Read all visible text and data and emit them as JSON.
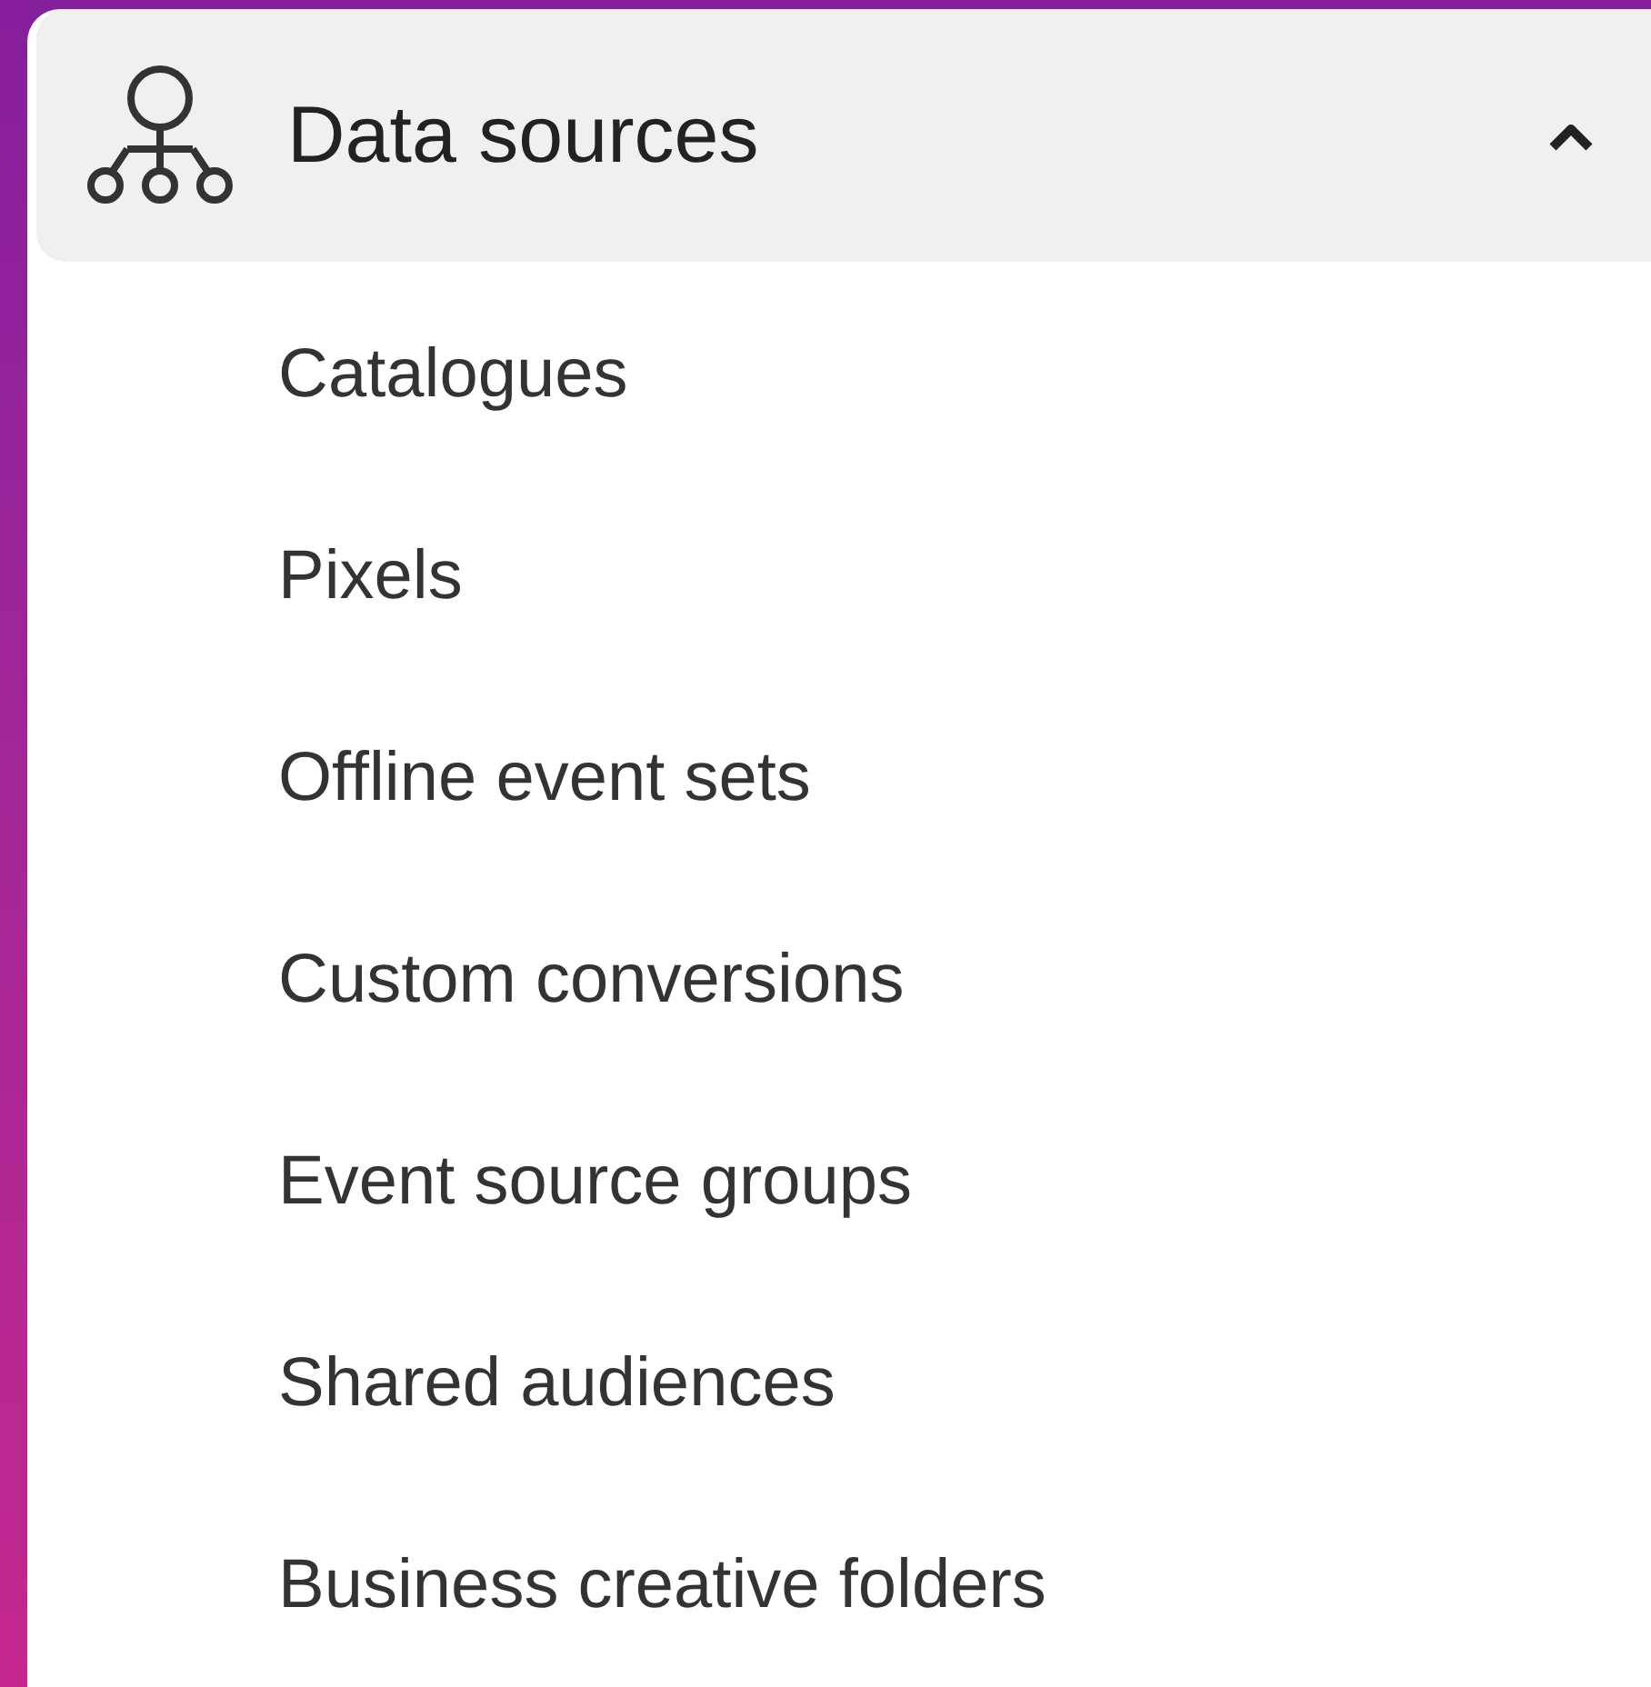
{
  "section": {
    "title": "Data sources",
    "expanded": true,
    "items": [
      {
        "label": "Catalogues"
      },
      {
        "label": "Pixels"
      },
      {
        "label": "Offline event sets"
      },
      {
        "label": "Custom conversions"
      },
      {
        "label": "Event source groups"
      },
      {
        "label": "Shared audiences"
      },
      {
        "label": "Business creative folders"
      }
    ]
  }
}
